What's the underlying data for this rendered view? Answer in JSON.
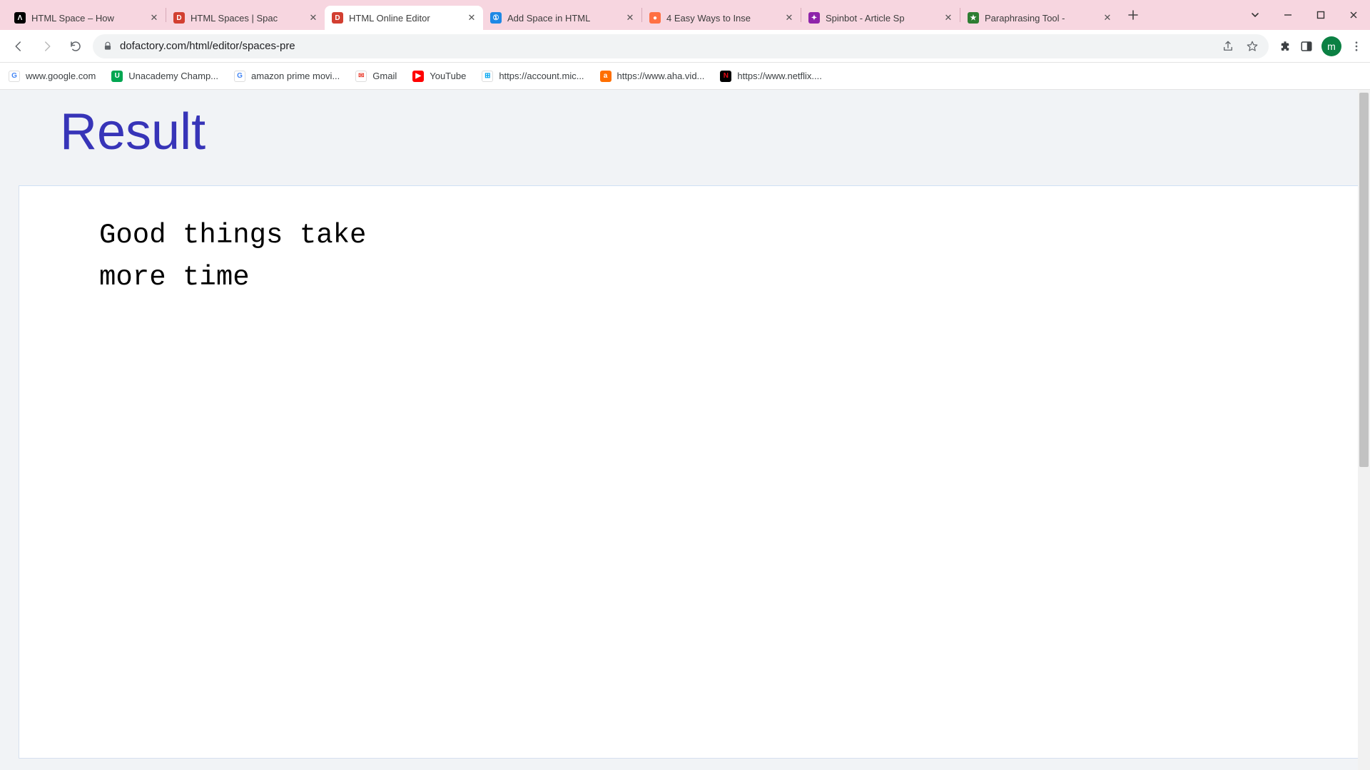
{
  "window": {
    "avatar_letter": "m"
  },
  "tabs": [
    {
      "title": "HTML Space – How",
      "favicon_bg": "#000000",
      "favicon_txt": "Λ"
    },
    {
      "title": "HTML Spaces | Spac",
      "favicon_bg": "#d23f31",
      "favicon_txt": "D"
    },
    {
      "title": "HTML Online Editor",
      "favicon_bg": "#d23f31",
      "favicon_txt": "D",
      "active": true
    },
    {
      "title": "Add Space in HTML",
      "favicon_bg": "#1e88e5",
      "favicon_txt": "①"
    },
    {
      "title": "4 Easy Ways to Inse",
      "favicon_bg": "#ff7043",
      "favicon_txt": "●"
    },
    {
      "title": "Spinbot - Article Sp",
      "favicon_bg": "#8e24aa",
      "favicon_txt": "✦"
    },
    {
      "title": "Paraphrasing Tool -",
      "favicon_bg": "#2e7d32",
      "favicon_txt": "★"
    }
  ],
  "omnibox": {
    "url": "dofactory.com/html/editor/spaces-pre"
  },
  "bookmarks": [
    {
      "label": "www.google.com",
      "ico_bg": "#ffffff",
      "ico_txt": "G",
      "ico_color": "#4285f4"
    },
    {
      "label": "Unacademy Champ...",
      "ico_bg": "#00a651",
      "ico_txt": "U"
    },
    {
      "label": "amazon prime movi...",
      "ico_bg": "#ffffff",
      "ico_txt": "G",
      "ico_color": "#4285f4"
    },
    {
      "label": "Gmail",
      "ico_bg": "#ffffff",
      "ico_txt": "✉",
      "ico_color": "#ea4335"
    },
    {
      "label": "YouTube",
      "ico_bg": "#ff0000",
      "ico_txt": "▶"
    },
    {
      "label": "https://account.mic...",
      "ico_bg": "#ffffff",
      "ico_txt": "⊞",
      "ico_color": "#00a4ef"
    },
    {
      "label": "https://www.aha.vid...",
      "ico_bg": "#ff6f00",
      "ico_txt": "a"
    },
    {
      "label": "https://www.netflix....",
      "ico_bg": "#000000",
      "ico_txt": "N",
      "ico_color": "#e50914"
    }
  ],
  "page": {
    "heading": "Result",
    "pre_text": "Good things take\nmore time"
  }
}
